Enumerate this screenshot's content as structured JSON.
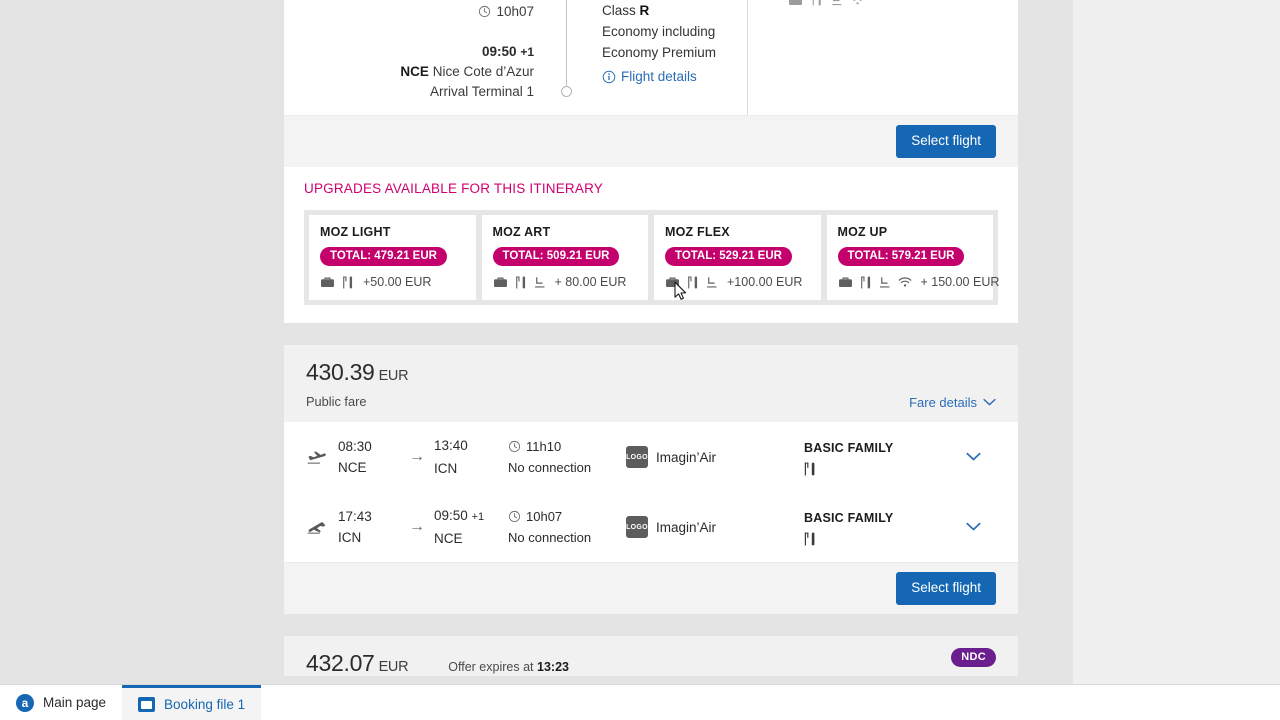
{
  "itinerary_top": {
    "duration": "10h07",
    "arrival_time": "09:50",
    "arrival_day_offset": "+1",
    "arrival_code": "NCE",
    "arrival_airport": "Nice Cote d’Azur",
    "arrival_terminal": "Arrival Terminal 1",
    "class_label": "Class",
    "class_value": "R",
    "cabin_line1": "Economy  including",
    "cabin_line2": "Economy Premium",
    "flight_details_link": "Flight details",
    "select_flight_label": "Select flight"
  },
  "upgrades": {
    "title": "UPGRADES AVAILABLE FOR THIS ITINERARY",
    "cards": [
      {
        "name": "MOZ LIGHT",
        "total": "TOTAL: 479.21 EUR",
        "price": "+50.00 EUR",
        "icons": [
          "baggage-icon",
          "meal-icon"
        ]
      },
      {
        "name": "MOZ ART",
        "total": "TOTAL: 509.21 EUR",
        "price": "+ 80.00 EUR",
        "icons": [
          "baggage-icon",
          "meal-icon",
          "seat-icon"
        ]
      },
      {
        "name": "MOZ FLEX",
        "total": "TOTAL: 529.21 EUR",
        "price": "+100.00 EUR",
        "icons": [
          "baggage-icon",
          "meal-icon",
          "seat-icon"
        ]
      },
      {
        "name": "MOZ UP",
        "total": "TOTAL: 579.21 EUR",
        "price": "+ 150.00 EUR",
        "icons": [
          "baggage-icon",
          "meal-icon",
          "seat-icon",
          "wifi-icon"
        ]
      }
    ]
  },
  "fare_offer": {
    "price": "430.39",
    "currency": "EUR",
    "fare_type": "Public fare",
    "fare_details_label": "Fare details",
    "select_flight_label": "Select flight",
    "segments": [
      {
        "direction_icon": "takeoff-icon",
        "dep_time": "08:30",
        "dep_code": "NCE",
        "arr_time": "13:40",
        "arr_day_offset": "",
        "arr_code": "ICN",
        "duration": "11h10",
        "connection": "No connection",
        "carrier_logo": "LOGO",
        "carrier": "Imagin’Air",
        "brand": "BASIC FAMILY",
        "brand_icons": [
          "meal-icon"
        ]
      },
      {
        "direction_icon": "landing-icon",
        "dep_time": "17:43",
        "dep_code": "ICN",
        "arr_time": "09:50",
        "arr_day_offset": "+1",
        "arr_code": "NCE",
        "duration": "10h07",
        "connection": "No connection",
        "carrier_logo": "LOGO",
        "carrier": "Imagin’Air",
        "brand": "BASIC FAMILY",
        "brand_icons": [
          "meal-icon"
        ]
      }
    ]
  },
  "fare_offer_next": {
    "price": "432.07",
    "currency": "EUR",
    "offer_expires_prefix": "Offer expires at",
    "offer_expires_time": "13:23",
    "badge": "NDC"
  },
  "taskbar": {
    "items": [
      {
        "label": "Main page",
        "icon": "amadeus-a-icon",
        "active": false
      },
      {
        "label": "Booking file 1",
        "icon": "booking-file-icon",
        "active": true
      }
    ]
  },
  "colors": {
    "accent_magenta": "#c3006b",
    "accent_blue": "#1567b3",
    "link_blue": "#2b6cb8",
    "ndc_purple": "#6b1f8e",
    "page_bg": "#e4e4e4",
    "panel_bg": "#f0f0f0"
  }
}
